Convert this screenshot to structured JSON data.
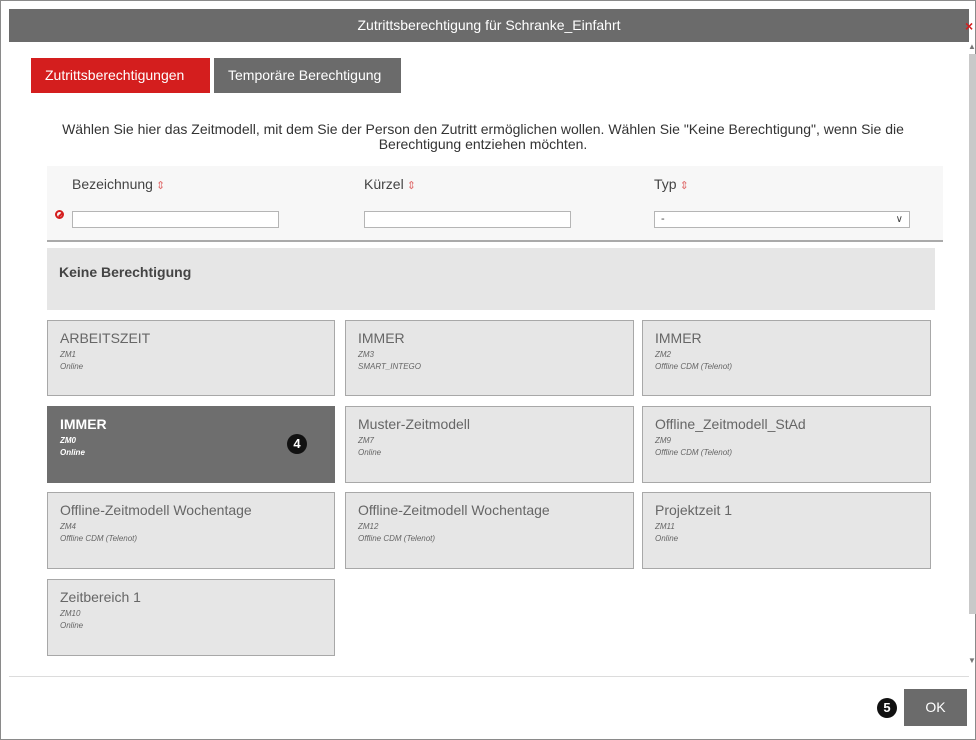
{
  "dialog": {
    "title": "Zutrittsberechtigung für Schranke_Einfahrt",
    "close_symbol": "×"
  },
  "tabs": [
    {
      "label": "Zutrittsberechtigungen",
      "active": true
    },
    {
      "label": "Temporäre Berechtigung",
      "active": false
    }
  ],
  "instruction": "Wählen Sie hier das Zeitmodell, mit dem Sie der Person den Zutritt ermöglichen wollen. Wählen Sie \"Keine Berechtigung\", wenn Sie die Berechtigung entziehen möchten.",
  "filters": {
    "columns": [
      {
        "label": "Bezeichnung",
        "sort_symbol": "⇕"
      },
      {
        "label": "Kürzel",
        "sort_symbol": "⇕"
      },
      {
        "label": "Typ",
        "sort_symbol": "⇕"
      }
    ],
    "type_selected": "-",
    "chevron": "∨"
  },
  "no_permission": {
    "label": "Keine Berechtigung"
  },
  "cards": [
    {
      "name": "ARBEITSZEIT",
      "code": "ZM1",
      "type": "Online",
      "selected": false
    },
    {
      "name": "IMMER",
      "code": "ZM3",
      "type": "SMART_INTEGO",
      "selected": false
    },
    {
      "name": "IMMER",
      "code": "ZM2",
      "type": "Offline CDM (Telenot)",
      "selected": false
    },
    {
      "name": "IMMER",
      "code": "ZM0",
      "type": "Online",
      "selected": true
    },
    {
      "name": "Muster-Zeitmodell",
      "code": "ZM7",
      "type": "Online",
      "selected": false
    },
    {
      "name": "Offline_Zeitmodell_StAd",
      "code": "ZM9",
      "type": "Offline CDM (Telenot)",
      "selected": false
    },
    {
      "name": "Offline-Zeitmodell Wochentage",
      "code": "ZM4",
      "type": "Offline CDM (Telenot)",
      "selected": false
    },
    {
      "name": "Offline-Zeitmodell Wochentage",
      "code": "ZM12",
      "type": "Offline CDM (Telenot)",
      "selected": false
    },
    {
      "name": "Projektzeit 1",
      "code": "ZM11",
      "type": "Online",
      "selected": false
    },
    {
      "name": "Zeitbereich 1",
      "code": "ZM10",
      "type": "Online",
      "selected": false
    }
  ],
  "markers": {
    "selected_card": "4",
    "ok_button": "5"
  },
  "footer": {
    "ok_label": "OK"
  },
  "colors": {
    "accent": "#d41e1e",
    "dark_gray": "#6b6b6b",
    "card_bg": "#e6e6e6"
  }
}
